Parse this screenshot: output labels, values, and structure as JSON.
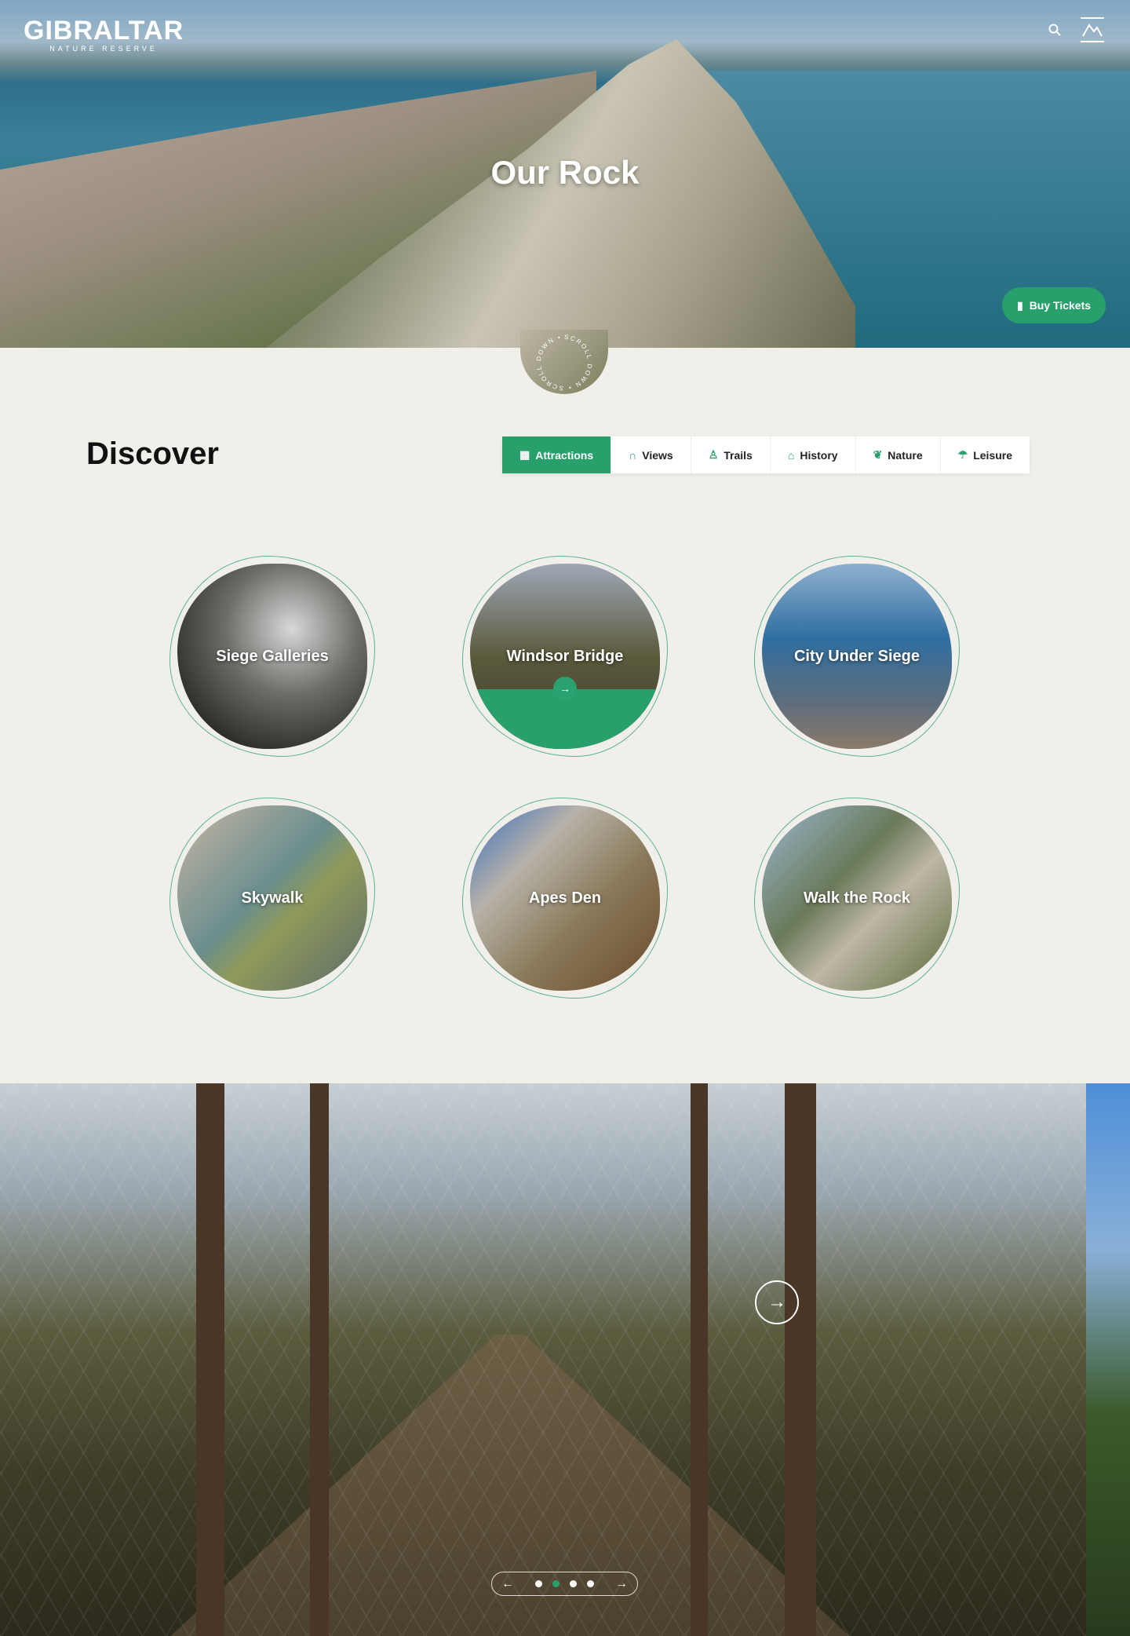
{
  "header": {
    "logo": "GIBRALTAR",
    "logo_sub": "NATURE RESERVE",
    "search_icon": "search-icon",
    "menu_icon": "menu-icon"
  },
  "hero": {
    "title": "Our Rock",
    "buy_tickets": "Buy Tickets",
    "scroll_text": "SCROLL DOWN • SCROLL DOWN •"
  },
  "discover": {
    "title": "Discover",
    "tabs": [
      {
        "label": "Attractions",
        "icon": "map-icon",
        "active": true
      },
      {
        "label": "Views",
        "icon": "binoculars-icon"
      },
      {
        "label": "Trails",
        "icon": "hiker-icon"
      },
      {
        "label": "History",
        "icon": "museum-icon"
      },
      {
        "label": "Nature",
        "icon": "leaf-icon"
      },
      {
        "label": "Leisure",
        "icon": "umbrella-icon"
      }
    ],
    "cards": [
      {
        "label": "Siege Galleries"
      },
      {
        "label": "Windsor Bridge"
      },
      {
        "label": "City Under Siege"
      },
      {
        "label": "Skywalk"
      },
      {
        "label": "Apes Den"
      },
      {
        "label": "Walk the Rock"
      }
    ]
  },
  "slider": {
    "slides": 4,
    "active": 2
  },
  "colors": {
    "accent": "#27a06c",
    "background": "#f1efea"
  }
}
